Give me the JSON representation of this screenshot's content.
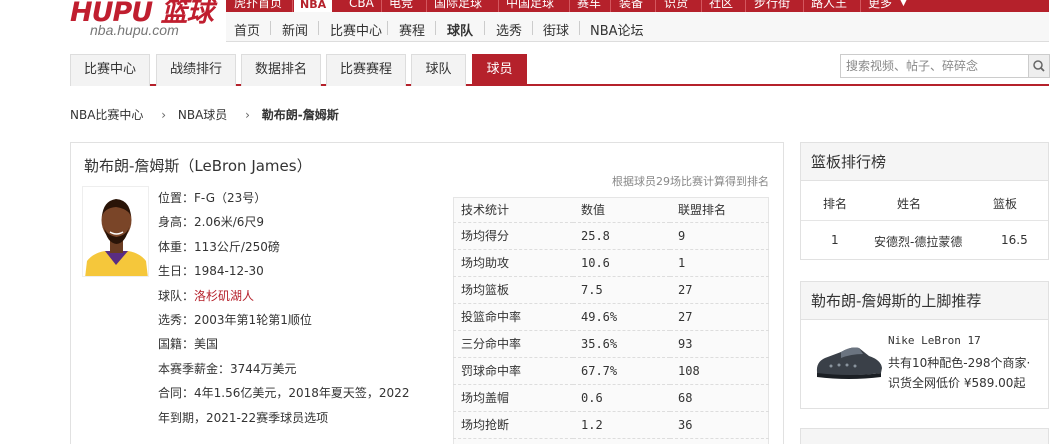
{
  "logo": {
    "main": "HUPU 篮球",
    "sub": "nba.hupu.com"
  },
  "topnav": {
    "items": [
      "虎扑首页",
      "NBA",
      "CBA",
      "电竞",
      "国际足球",
      "中国足球",
      "赛车",
      "装备",
      "识货",
      "社区",
      "步行街",
      "路人王",
      "更多"
    ]
  },
  "subnav": {
    "items": [
      "首页",
      "新闻",
      "比赛中心",
      "赛程",
      "球队",
      "选秀",
      "街球",
      "NBA论坛"
    ]
  },
  "tabs": [
    "比赛中心",
    "战绩排行",
    "数据排名",
    "比赛赛程",
    "球队",
    "球员"
  ],
  "search": {
    "placeholder": "搜索视频、帖子、碎碎念"
  },
  "breadcrumb": {
    "items": [
      "NBA比赛中心",
      "NBA球员",
      "勒布朗-詹姆斯"
    ]
  },
  "player": {
    "title": "勒布朗-詹姆斯（LeBron James）",
    "note": "根据球员29场比赛计算得到排名",
    "info": [
      {
        "label": "位置：",
        "value": "F-G（23号）"
      },
      {
        "label": "身高：",
        "value": "2.06米/6尺9"
      },
      {
        "label": "体重：",
        "value": "113公斤/250磅"
      },
      {
        "label": "生日：",
        "value": "1984-12-30"
      },
      {
        "label": "球队：",
        "value": "洛杉矶湖人"
      },
      {
        "label": "选秀：",
        "value": "2003年第1轮第1顺位"
      },
      {
        "label": "国籍：",
        "value": "美国"
      },
      {
        "label": "本赛季薪金：",
        "value": "3744万美元"
      },
      {
        "label": "合同：",
        "value": "4年1.56亿美元，2018年夏天签，2022"
      },
      {
        "label": "",
        "value": "年到期，2021-22赛季球员选项"
      }
    ]
  },
  "stats": {
    "headers": [
      "技术统计",
      "数值",
      "联盟排名"
    ],
    "rows": [
      [
        "场均得分",
        "25.8",
        "9"
      ],
      [
        "场均助攻",
        "10.6",
        "1"
      ],
      [
        "场均篮板",
        "7.5",
        "27"
      ],
      [
        "投篮命中率",
        "49.6%",
        "27"
      ],
      [
        "三分命中率",
        "35.6%",
        "93"
      ],
      [
        "罚球命中率",
        "67.7%",
        "108"
      ],
      [
        "场均盖帽",
        "0.6",
        "68"
      ],
      [
        "场均抢断",
        "1.2",
        "36"
      ]
    ]
  },
  "rebound_rank": {
    "title": "篮板排行榜",
    "headers": [
      "排名",
      "姓名",
      "篮板"
    ],
    "rows": [
      [
        "1",
        "安德烈-德拉蒙德",
        "16.5"
      ]
    ]
  },
  "shoe_box": {
    "title": "勒布朗-詹姆斯的上脚推荐",
    "name": "Nike LeBron 17",
    "desc": "共有10种配色-298个商家·",
    "price": "识货全网低价 ¥589.00起"
  },
  "colors": {
    "accent": "#b5212b"
  }
}
